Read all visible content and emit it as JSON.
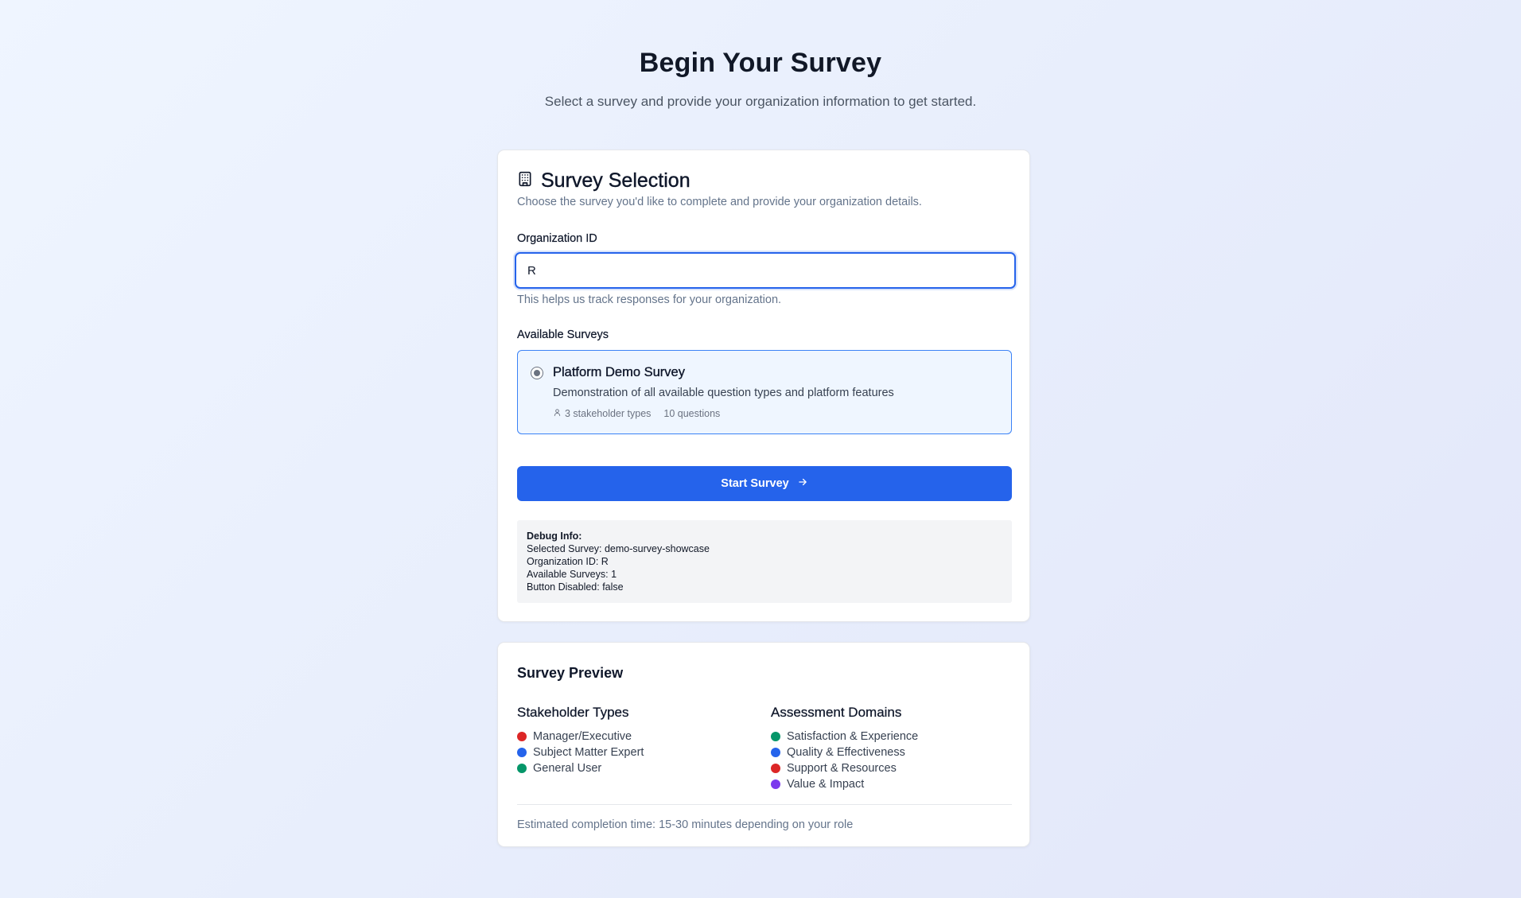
{
  "header": {
    "title": "Begin Your Survey",
    "subtitle": "Select a survey and provide your organization information to get started."
  },
  "selection": {
    "icon": "building-icon",
    "title": "Survey Selection",
    "description": "Choose the survey you'd like to complete and provide your organization details.",
    "org_label": "Organization ID",
    "org_value": "R",
    "org_help": "This helps us track responses for your organization.",
    "surveys_label": "Available Surveys",
    "survey_option": {
      "selected": true,
      "title": "Platform Demo Survey",
      "description": "Demonstration of all available question types and platform features",
      "stakeholders": "3 stakeholder types",
      "questions": "10 questions"
    },
    "start_label": "Start Survey",
    "debug": {
      "title": "Debug Info:",
      "lines": [
        "Selected Survey: demo-survey-showcase",
        "Organization ID: R",
        "Available Surveys: 1",
        "Button Disabled: false"
      ]
    }
  },
  "preview": {
    "title": "Survey Preview",
    "stakeholders_title": "Stakeholder Types",
    "stakeholders": [
      {
        "label": "Manager/Executive",
        "color": "#dc2626"
      },
      {
        "label": "Subject Matter Expert",
        "color": "#2563eb"
      },
      {
        "label": "General User",
        "color": "#059669"
      }
    ],
    "domains_title": "Assessment Domains",
    "domains": [
      {
        "label": "Satisfaction & Experience",
        "color": "#059669"
      },
      {
        "label": "Quality & Effectiveness",
        "color": "#2563eb"
      },
      {
        "label": "Support & Resources",
        "color": "#dc2626"
      },
      {
        "label": "Value & Impact",
        "color": "#7c3aed"
      }
    ],
    "estimate": "Estimated completion time: 15-30 minutes depending on your role"
  },
  "colors": {
    "accent": "#2563eb",
    "selected_bg": "#eff6ff"
  }
}
